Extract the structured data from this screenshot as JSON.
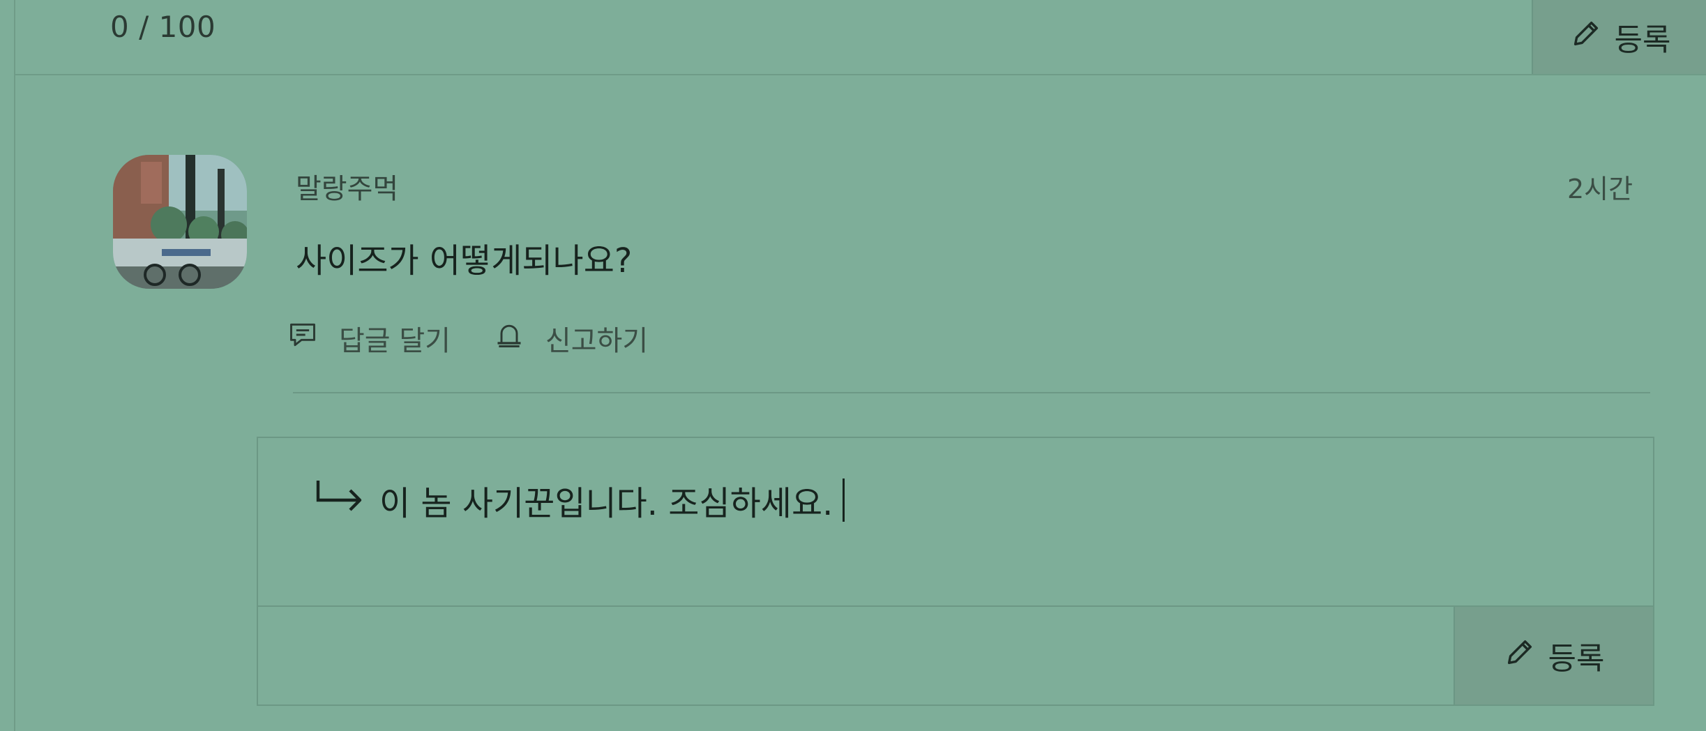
{
  "top_form": {
    "char_count": "0 / 100",
    "submit_label": "등록",
    "submit_icon": "pencil-icon"
  },
  "comment": {
    "author": "말랑주먹",
    "time": "2시간",
    "text": "사이즈가 어떻게되나요?",
    "avatar_icon": "avatar",
    "actions": [
      {
        "label": "답글 달기",
        "icon": "speech-bubble-icon"
      },
      {
        "label": "신고하기",
        "icon": "siren-icon"
      }
    ]
  },
  "reply_form": {
    "text": "이 놈 사기꾼입니다. 조심하세요.",
    "submit_label": "등록",
    "submit_icon": "pencil-icon",
    "arrow_icon": "reply-arrow-icon"
  },
  "colors": {
    "background": "#7eae99",
    "button_bg": "#779f8d",
    "border": "#6c9885",
    "text": "#17231e"
  }
}
